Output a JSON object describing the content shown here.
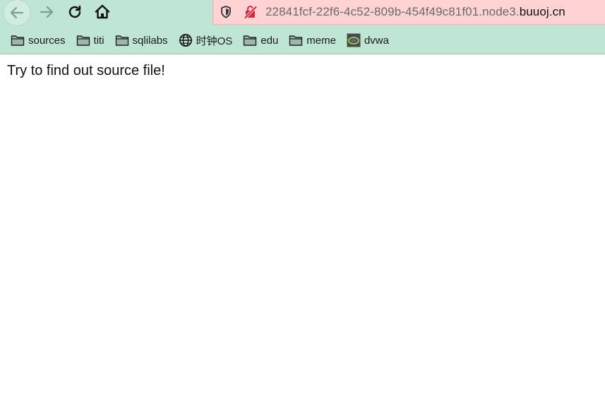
{
  "browser": {
    "url_prefix": "22841fcf-22f6-4c52-809b-454f49c81f01.node3.",
    "url_domain": "buuoj.cn",
    "chrome_color": "#bfe5d5",
    "insecure_urlbar_color": "#ffd3d3",
    "icons": {
      "back": "arrow-left-icon",
      "forward": "arrow-right-icon",
      "reload": "reload-icon",
      "home": "home-icon",
      "shield": "shield-icon",
      "insecure": "insecure-connection-icon"
    }
  },
  "bookmarks": [
    {
      "label": "sources",
      "icon": "folder-icon"
    },
    {
      "label": "titi",
      "icon": "folder-icon"
    },
    {
      "label": "sqlilabs",
      "icon": "folder-icon"
    },
    {
      "label": "时钟OS",
      "icon": "globe-icon"
    },
    {
      "label": "edu",
      "icon": "folder-icon"
    },
    {
      "label": "meme",
      "icon": "folder-icon"
    },
    {
      "label": "dvwa",
      "icon": "dvwa-favicon-icon"
    }
  ],
  "page": {
    "text": "Try to find out source file!"
  }
}
